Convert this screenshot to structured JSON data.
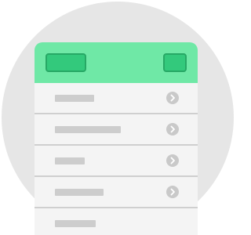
{
  "app": {
    "header": {
      "left_button_icon": "rounded-rect-button",
      "right_button_icon": "rounded-square-button",
      "color": "#6fe8a6"
    },
    "list": {
      "items": [
        {
          "icon": "chevron-right-icon",
          "placeholder_text": ""
        },
        {
          "icon": "chevron-right-icon",
          "placeholder_text": ""
        },
        {
          "icon": "chevron-right-icon",
          "placeholder_text": ""
        },
        {
          "icon": "chevron-right-icon",
          "placeholder_text": ""
        },
        {
          "icon": "",
          "placeholder_text": ""
        }
      ]
    },
    "colors": {
      "background_circle": "#e6e6e6",
      "header_green": "#6fe8a6",
      "button_green": "#33c97c",
      "list_background": "#f4f4f4",
      "placeholder_bar": "#cdcdcd",
      "chevron_circle": "#c9c9c9"
    }
  }
}
